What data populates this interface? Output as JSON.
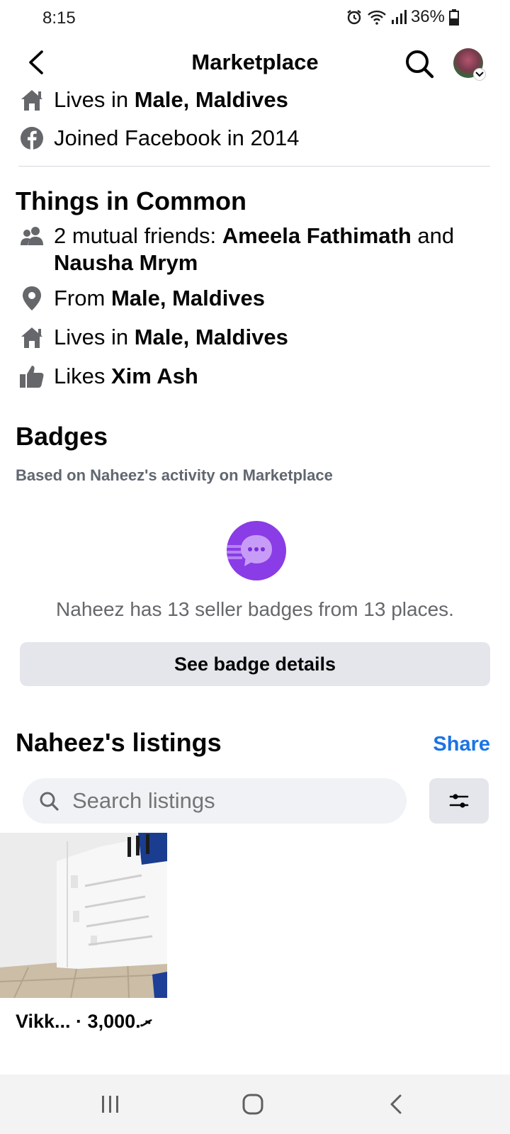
{
  "status_bar": {
    "time": "8:15",
    "battery": "36%",
    "icons": [
      "alarm-icon",
      "wifi-icon",
      "signal-icon",
      "battery-icon"
    ]
  },
  "header": {
    "title": "Marketplace",
    "back_icon": "chevron-left-icon",
    "search_icon": "search-icon"
  },
  "about": {
    "lives_prefix": "Lives in ",
    "lives_place": "Male, Maldives",
    "joined": "Joined Facebook in 2014"
  },
  "common": {
    "title": "Things in Common",
    "mutual_prefix": "2 mutual friends: ",
    "mutual_friend_1": "Ameela Fathimath",
    "mutual_and": " and ",
    "mutual_friend_2": "Nausha Mrym",
    "from_prefix": "From ",
    "from_place": "Male, Maldives",
    "lives_prefix": "Lives in ",
    "lives_place": "Male, Maldives",
    "likes_prefix": "Likes ",
    "likes_value": "Xim Ash"
  },
  "badges": {
    "title": "Badges",
    "subtitle": "Based on Naheez's activity on Marketplace",
    "summary": "Naheez has 13 seller badges from 13 places.",
    "button_label": "See badge details",
    "badge_color": "#8a3ce6"
  },
  "listings": {
    "title": "Naheez's listings",
    "share_label": "Share",
    "search_placeholder": "Search listings",
    "items": [
      {
        "caption": "Vikk... · 3,000.ރ"
      }
    ]
  },
  "colors": {
    "accent": "#1b74e4",
    "icon_gray": "#65676b",
    "button_gray": "#e4e6eb"
  }
}
